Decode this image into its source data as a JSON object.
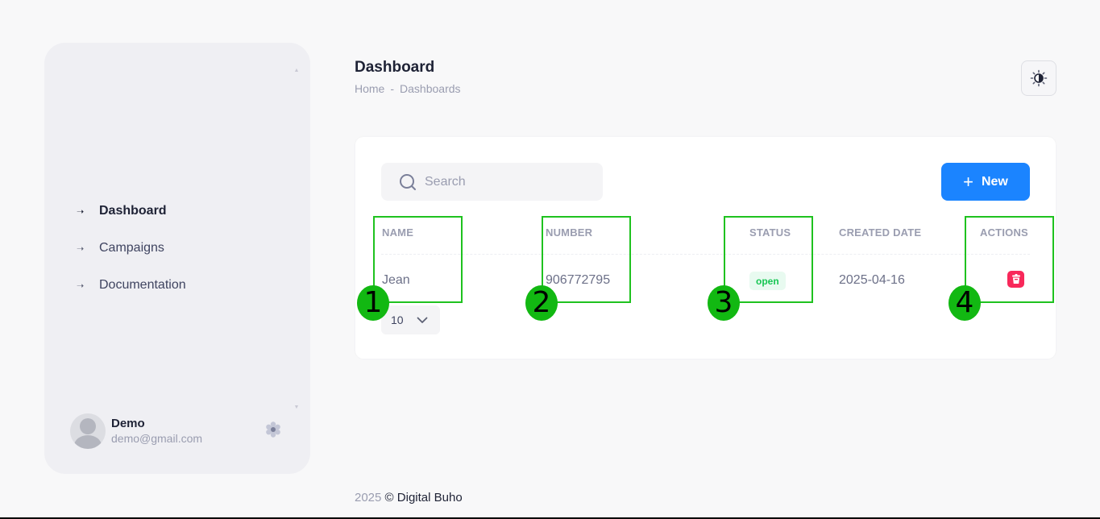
{
  "sidebar": {
    "items": [
      {
        "label": "Dashboard",
        "active": true
      },
      {
        "label": "Campaigns",
        "active": false
      },
      {
        "label": "Documentation",
        "active": false
      }
    ],
    "user": {
      "name": "Demo",
      "email": "demo@gmail.com"
    }
  },
  "header": {
    "title": "Dashboard",
    "breadcrumb": [
      "Home",
      "-",
      "Dashboards"
    ]
  },
  "toolbar": {
    "search_placeholder": "Search",
    "new_label": "New"
  },
  "table": {
    "columns": [
      "NAME",
      "NUMBER",
      "STATUS",
      "CREATED DATE",
      "ACTIONS"
    ],
    "rows": [
      {
        "name": "Jean",
        "number": "906772795",
        "status": "open",
        "created_date": "2025-04-16"
      }
    ],
    "page_size": "10"
  },
  "annotations": [
    "1",
    "2",
    "3",
    "4"
  ],
  "footer": {
    "year": "2025",
    "copyright": "©",
    "brand": "Digital Buho"
  },
  "colors": {
    "primary": "#1b84ff",
    "danger": "#f8285a",
    "success": "#17c653",
    "annotation": "#1fc21f"
  }
}
